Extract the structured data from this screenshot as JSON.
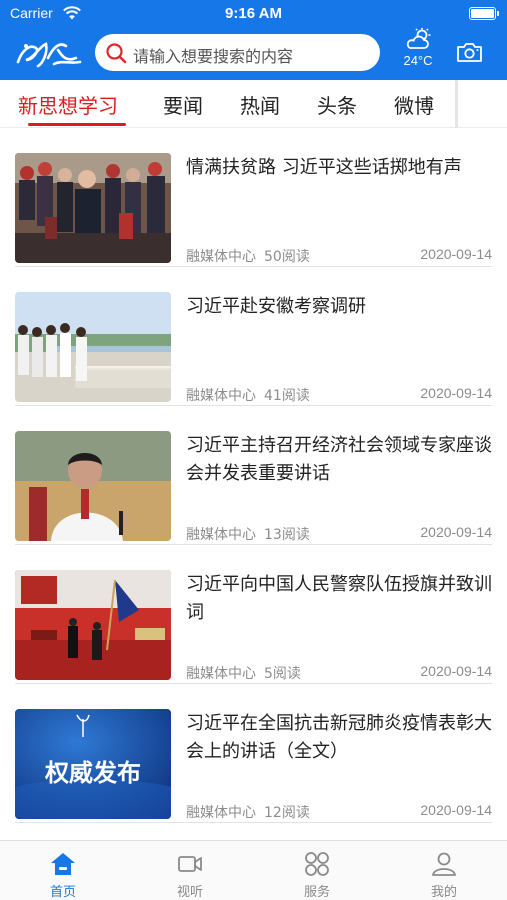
{
  "status_bar": {
    "carrier": "Carrier",
    "time": "9:16 AM"
  },
  "header": {
    "search_placeholder": "请输入想要搜索的内容",
    "temperature": "24°C",
    "logo_icon": "app-logo",
    "weather_icon": "partly-sunny-icon",
    "camera_icon": "camera-icon",
    "accent_color": "#1677e8"
  },
  "tabs": [
    {
      "label": "新思想学习",
      "active": true
    },
    {
      "label": "要闻"
    },
    {
      "label": "热闻"
    },
    {
      "label": "头条"
    },
    {
      "label": "微博"
    }
  ],
  "tab_active_color": "#d81e1e",
  "news": [
    {
      "title": "情满扶贫路 习近平这些话掷地有声",
      "source": "融媒体中心",
      "reads": "50阅读",
      "date": "2020-09-14"
    },
    {
      "title": "习近平赴安徽考察调研",
      "source": "融媒体中心",
      "reads": "41阅读",
      "date": "2020-09-14"
    },
    {
      "title": "习近平主持召开经济社会领域专家座谈会并发表重要讲话",
      "source": "融媒体中心",
      "reads": "13阅读",
      "date": "2020-09-14"
    },
    {
      "title": "习近平向中国人民警察队伍授旗并致训词",
      "source": "融媒体中心",
      "reads": "5阅读",
      "date": "2020-09-14"
    },
    {
      "title": "习近平在全国抗击新冠肺炎疫情表彰大会上的讲话（全文）",
      "source": "融媒体中心",
      "reads": "12阅读",
      "date": "2020-09-14",
      "thumb_text": "权威发布"
    }
  ],
  "bottom_nav": [
    {
      "label": "首页",
      "icon": "home-icon",
      "active": true
    },
    {
      "label": "视听",
      "icon": "video-icon"
    },
    {
      "label": "服务",
      "icon": "grid-icon"
    },
    {
      "label": "我的",
      "icon": "user-icon"
    }
  ]
}
